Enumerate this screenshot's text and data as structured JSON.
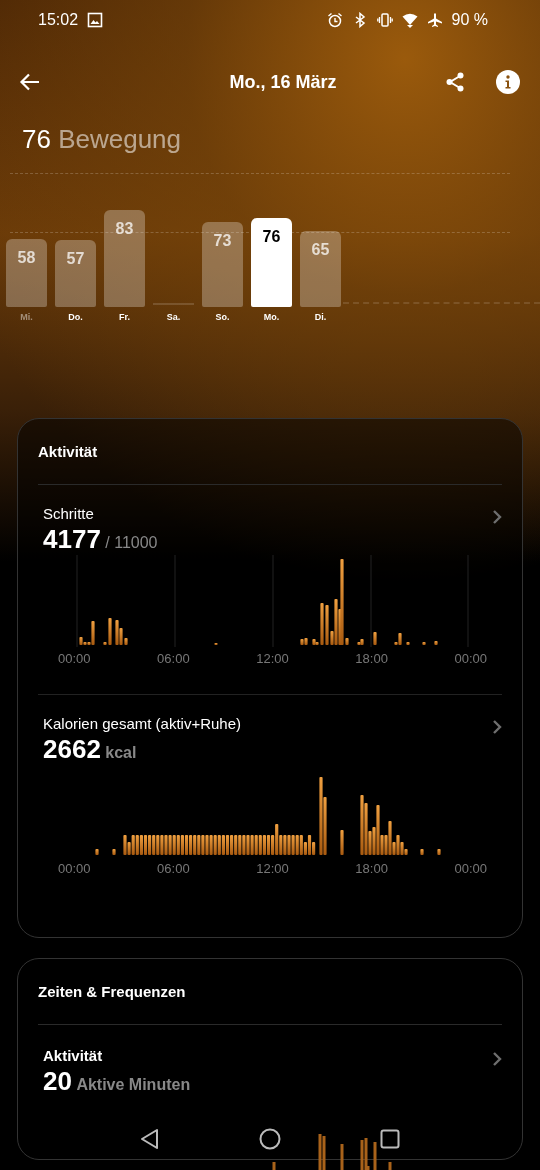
{
  "status_bar": {
    "time": "15:02",
    "battery": "90 %"
  },
  "header": {
    "title": "Mo., 16 März"
  },
  "summary": {
    "value": "76",
    "label": "Bewegung"
  },
  "week": {
    "chart_data": {
      "type": "bar",
      "categories": [
        "Mi.",
        "Do.",
        "Fr.",
        "Sa.",
        "So.",
        "Mo.",
        "Di."
      ],
      "values": [
        58,
        57,
        83,
        null,
        73,
        76,
        65
      ],
      "data_labels": true
    },
    "bars": [
      {
        "selected": false
      },
      {
        "selected": false
      },
      {
        "selected": false
      },
      {
        "selected": false
      },
      {
        "selected": false
      },
      {
        "selected": true
      },
      {
        "selected": false
      }
    ]
  },
  "activity_card": {
    "title": "Aktivität",
    "metrics": [
      {
        "kind": "steps",
        "label": "Schritte",
        "value": "4177",
        "unit": "/ 11000",
        "axis_labels": [
          "00:00",
          "06:00",
          "12:00",
          "18:00",
          "00:00"
        ]
      },
      {
        "kind": "calories",
        "label": "Kalorien gesamt (aktiv+Ruhe)",
        "value": "2662",
        "unit": "kcal",
        "axis_labels": [
          "00:00",
          "06:00",
          "12:00",
          "18:00",
          "00:00"
        ]
      }
    ]
  },
  "times_card": {
    "title": "Zeiten & Frequenzen",
    "metrics": [
      {
        "label": "Aktivität",
        "value": "20",
        "unit": "Aktive Minuten"
      }
    ]
  }
}
